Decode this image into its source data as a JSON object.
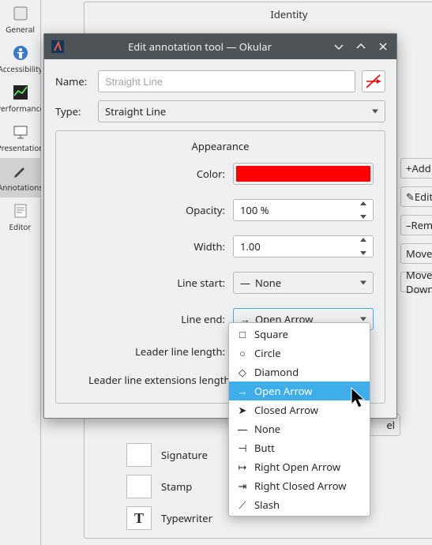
{
  "bg": {
    "sidebar": [
      {
        "label": "General"
      },
      {
        "label": "Accessibility"
      },
      {
        "label": "Performance"
      },
      {
        "label": "Presentation"
      },
      {
        "label": "Annotations"
      },
      {
        "label": "Editor"
      }
    ],
    "groupbox_title": "Identity",
    "side_buttons": [
      "Add",
      "Edit",
      "Remove",
      "Move Up",
      "Move Down"
    ],
    "list_rows": [
      "Signature",
      "Stamp",
      "Typewriter"
    ],
    "cancel_button": "el"
  },
  "dialog": {
    "title": "Edit annotation tool — Okular",
    "name_label": "Name:",
    "name_placeholder": "Straight Line",
    "type_label": "Type:",
    "type_value": "Straight Line",
    "appearance_title": "Appearance",
    "rows": {
      "color_label": "Color:",
      "color_value": "#ff0000",
      "opacity_label": "Opacity:",
      "opacity_value": "100 %",
      "width_label": "Width:",
      "width_value": "1.00",
      "line_start_label": "Line start:",
      "line_start_value": "None",
      "line_end_label": "Line end:",
      "line_end_value": "Open Arrow",
      "leader_len_label": "Leader line length:",
      "leader_ext_label": "Leader line extensions length:"
    }
  },
  "dropdown": {
    "selected_index": 3,
    "options": [
      {
        "glyph": "□",
        "label": "Square"
      },
      {
        "glyph": "○",
        "label": "Circle"
      },
      {
        "glyph": "◇",
        "label": "Diamond"
      },
      {
        "glyph": "→",
        "label": "Open Arrow"
      },
      {
        "glyph": "➤",
        "label": "Closed Arrow"
      },
      {
        "glyph": "—",
        "label": "None"
      },
      {
        "glyph": "⊣",
        "label": "Butt"
      },
      {
        "glyph": "↦",
        "label": "Right Open Arrow"
      },
      {
        "glyph": "⇥",
        "label": "Right Closed Arrow"
      },
      {
        "glyph": "⟋",
        "label": "Slash"
      }
    ]
  }
}
